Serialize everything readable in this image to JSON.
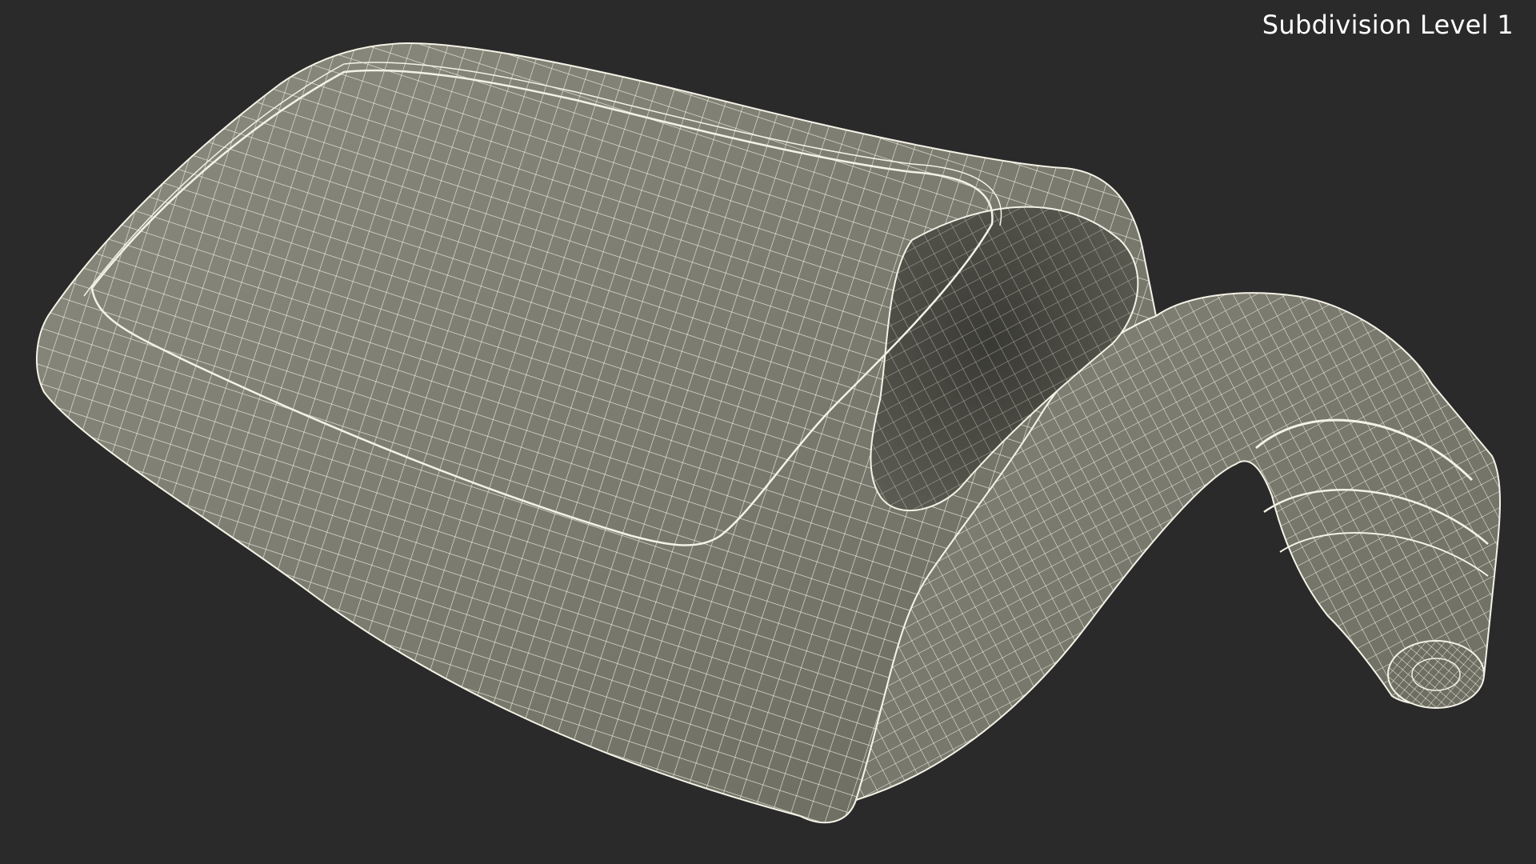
{
  "viewport": {
    "overlay_label": "Subdivision Level 1",
    "background_color": "#2a2a2a",
    "wire_color": "#f4f2e6",
    "surface_color": "#7b7b6f",
    "model_description_icon": "wireframe-bottle-model"
  }
}
